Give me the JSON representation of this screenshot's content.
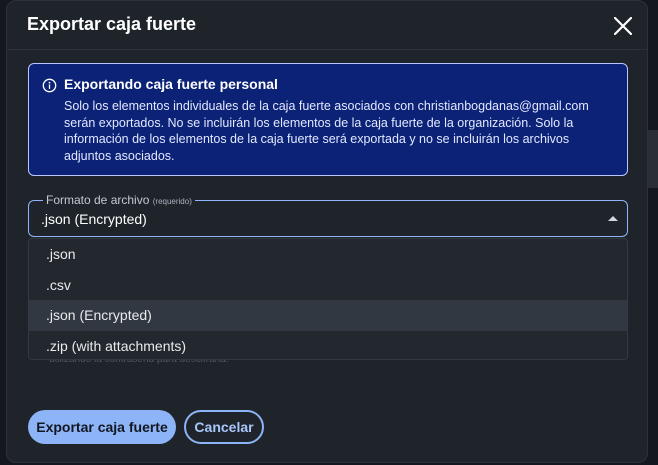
{
  "dialog": {
    "title": "Exportar caja fuerte",
    "close_icon": "close-icon"
  },
  "callout": {
    "icon": "info-icon",
    "title": "Exportando caja fuerte personal",
    "body": "Solo los elementos individuales de la caja fuerte asociados con christianbogdanas@gmail.com serán exportados. No se incluirán los elementos de la caja fuerte de la organización. Solo la información de los elementos de la caja fuerte será exportada y no se incluirán los archivos adjuntos asociados.",
    "colors": {
      "background": "#0b2277",
      "border": "#b9c6ff"
    }
  },
  "file_format": {
    "label": "Formato de archivo",
    "required_tag": "(requerido)",
    "value": ".json (Encrypted)",
    "options": [
      ".json",
      ".csv",
      ".json (Encrypted)",
      ".zip (with attachments)"
    ],
    "selected_index": 2
  },
  "partial_hint": "utilizando la contraseña para descifrarla.",
  "actions": {
    "export_label": "Exportar caja fuerte",
    "cancel_label": "Cancelar"
  },
  "colors": {
    "accent": "#8db4f6",
    "dialog_bg": "#1f242b"
  }
}
